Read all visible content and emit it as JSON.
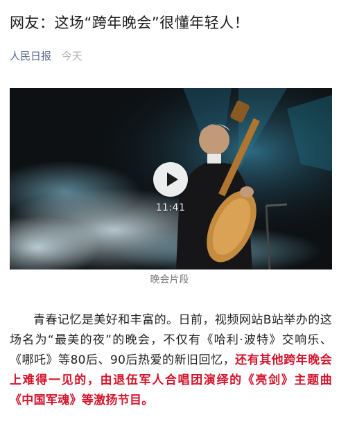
{
  "article": {
    "title": "网友：这场“跨年晚会”很懂年轻人！",
    "source": "人民日报",
    "time": "今天"
  },
  "video": {
    "duration": "11:41",
    "caption": "晚会片段",
    "play_icon": "play-icon"
  },
  "body": {
    "plain": "青春记忆是美好和丰富的。日前，视频网站B站举办的这场名为“最美的夜”的晚会，不仅有《哈利·波特》交响乐、《哪吒》等80后、90后热爱的新旧回忆，",
    "highlight": "还有其他跨年晚会上难得一见的，由退伍军人合唱团演绎的《亮剑》主题曲《中国军魂》等激扬节目。"
  },
  "colors": {
    "source_link": "#576b95",
    "highlight": "#d4142b",
    "caption": "#7a7a7a"
  }
}
